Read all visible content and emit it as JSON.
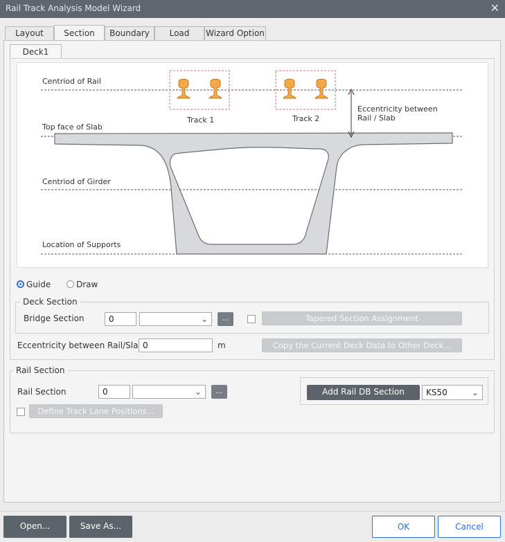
{
  "window": {
    "title": "Rail Track Analysis Model Wizard"
  },
  "tabs": [
    {
      "label": "Layout"
    },
    {
      "label": "Section"
    },
    {
      "label": "Boundary"
    },
    {
      "label": "Load"
    },
    {
      "label": "Wizard Option"
    }
  ],
  "subtabs": [
    {
      "label": "Deck1"
    }
  ],
  "diagram": {
    "centroid_rail": "Centriod of Rail",
    "top_slab": "Top face of Slab",
    "centroid_girder": "Centriod of Girder",
    "supports": "Location of Supports",
    "track1": "Track 1",
    "track2": "Track 2",
    "eccentricity_line1": "Eccentricity between",
    "eccentricity_line2": "Rail / Slab"
  },
  "mode": {
    "guide": "Guide",
    "draw": "Draw",
    "selected": "Guide"
  },
  "deck_section": {
    "title": "Deck Section",
    "bridge_section_label": "Bridge Section",
    "bridge_section_value": "0",
    "dots": "...",
    "tapered_button": "Tapered Section Assignment",
    "eccentricity_label": "Eccentricity between Rail/Slab",
    "eccentricity_value": "0",
    "eccentricity_unit": "m",
    "copy_button": "Copy the Current Deck Data to Other Deck..."
  },
  "rail_section": {
    "title": "Rail Section",
    "rail_section_label": "Rail Section",
    "rail_section_value": "0",
    "dots": "...",
    "define_button": "Define Track Lane Positions...",
    "add_db_button": "Add Rail DB Section",
    "db_value": "KS50"
  },
  "footer": {
    "open": "Open...",
    "save_as": "Save As...",
    "ok": "OK",
    "cancel": "Cancel"
  }
}
